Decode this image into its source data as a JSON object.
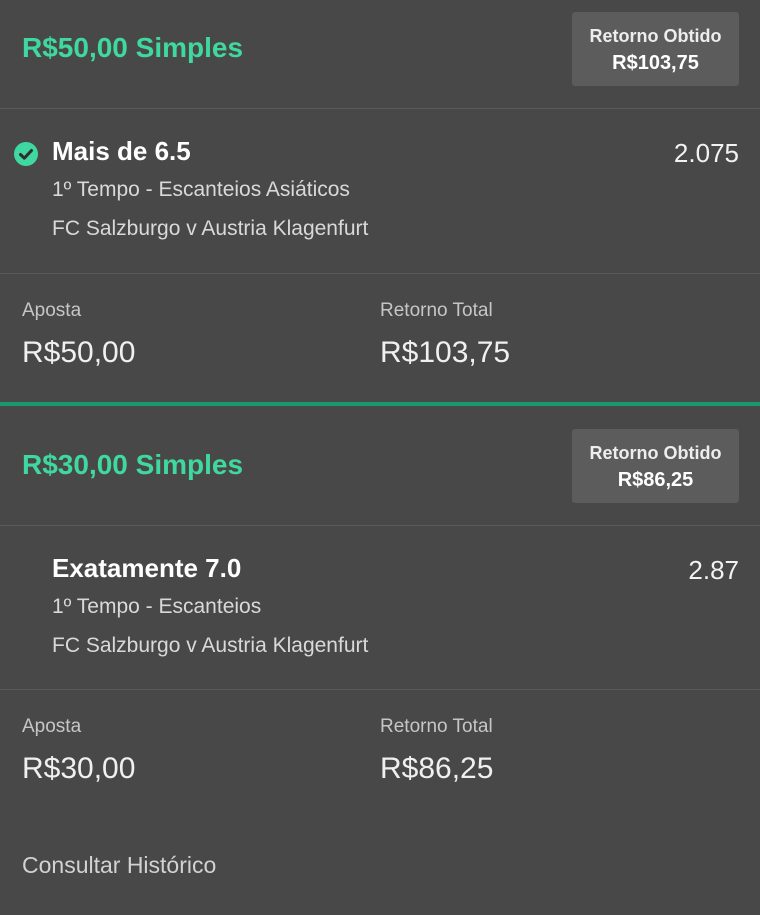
{
  "bets": [
    {
      "title": "R$50,00 Simples",
      "return_label": "Retorno Obtido",
      "return_value": "R$103,75",
      "selection": {
        "name": "Mais de 6.5",
        "odds": "2.075",
        "market": "1º Tempo - Escanteios Asiáticos",
        "event": "FC Salzburgo v Austria Klagenfurt",
        "status": "won"
      },
      "stake_label": "Aposta",
      "stake_value": "R$50,00",
      "total_label": "Retorno Total",
      "total_value": "R$103,75"
    },
    {
      "title": "R$30,00 Simples",
      "return_label": "Retorno Obtido",
      "return_value": "R$86,25",
      "selection": {
        "name": "Exatamente 7.0",
        "odds": "2.87",
        "market": "1º Tempo - Escanteios",
        "event": "FC Salzburgo v Austria Klagenfurt",
        "status": "none"
      },
      "stake_label": "Aposta",
      "stake_value": "R$30,00",
      "total_label": "Retorno Total",
      "total_value": "R$86,25"
    }
  ],
  "footer": {
    "history_link": "Consultar Histórico"
  },
  "colors": {
    "background": "#484848",
    "accent_green": "#3fd8a0",
    "divider_green": "#1a9a6c",
    "box_gray": "#5c5c5c"
  },
  "icons": {
    "win_icon": "check-circle-icon"
  }
}
